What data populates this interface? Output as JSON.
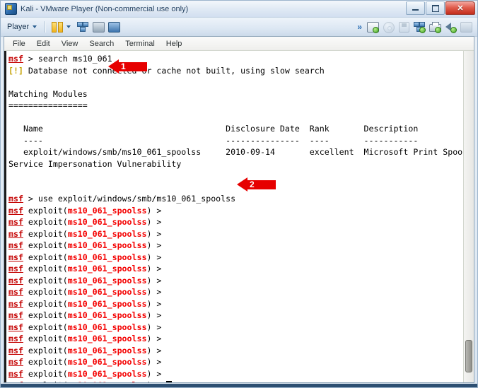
{
  "window": {
    "title": "Kali - VMware Player (Non-commercial use only)",
    "icon": "vmware-kali-icon",
    "controls": {
      "minimize": "minimize-button",
      "maximize": "maximize-button",
      "close_label": "✕"
    }
  },
  "vm_toolbar": {
    "player_label": "Player",
    "player_caret": "chevron-down-icon",
    "left_icons": [
      {
        "name": "pause-vm-icon",
        "label": "Pause"
      },
      {
        "name": "pause-dropdown-caret-icon",
        "label": "Pause options"
      },
      {
        "name": "send-ctrl-alt-del-icon",
        "label": "Send Ctrl+Alt+Del"
      },
      {
        "name": "enter-fullscreen-icon",
        "label": "Enter full screen"
      },
      {
        "name": "unity-mode-icon",
        "label": "Unity"
      }
    ],
    "right_icons": [
      {
        "name": "expand-status-chevron-icon",
        "label": "»"
      },
      {
        "name": "hard-disk-status-icon",
        "label": "Hard Disk"
      },
      {
        "name": "cd-dvd-status-icon",
        "label": "CD/DVD"
      },
      {
        "name": "floppy-status-icon",
        "label": "Floppy"
      },
      {
        "name": "network-adapter-status-icon",
        "label": "Network Adapter"
      },
      {
        "name": "printer-status-icon",
        "label": "Printer"
      },
      {
        "name": "sound-card-status-icon",
        "label": "Sound Card"
      },
      {
        "name": "usb-status-icon",
        "label": "USB"
      }
    ]
  },
  "terminal": {
    "menu": [
      "File",
      "Edit",
      "View",
      "Search",
      "Terminal",
      "Help"
    ],
    "prompt_user": "msf",
    "prompt_arrow": ">",
    "module_short_name": "ms10_061_spoolss",
    "exploit_word": "exploit",
    "lines": [
      {
        "type": "cmd",
        "prompt": "msf",
        "text": " > search ms10_061"
      },
      {
        "type": "warn",
        "tag": "[!]",
        "text": " Database not connected or cache not built, using slow search"
      },
      {
        "type": "blank",
        "text": ""
      },
      {
        "type": "plain",
        "text": "Matching Modules"
      },
      {
        "type": "plain",
        "text": "================"
      },
      {
        "type": "blank",
        "text": ""
      },
      {
        "type": "plain",
        "text": "   Name                                     Disclosure Date  Rank       Description"
      },
      {
        "type": "plain",
        "text": "   ----                                     ---------------  ----       -----------"
      },
      {
        "type": "plain",
        "text": "   exploit/windows/smb/ms10_061_spoolss     2010-09-14       excellent  Microsoft Print Spooler"
      },
      {
        "type": "plain",
        "text": "Service Impersonation Vulnerability"
      },
      {
        "type": "blank",
        "text": ""
      },
      {
        "type": "blank",
        "text": ""
      },
      {
        "type": "cmd",
        "prompt": "msf",
        "text": " > use exploit/windows/smb/ms10_061_spoolss"
      }
    ],
    "module_table": {
      "headers": [
        "Name",
        "Disclosure Date",
        "Rank",
        "Description"
      ],
      "rows": [
        {
          "name": "exploit/windows/smb/ms10_061_spoolss",
          "disclosure_date": "2010-09-14",
          "rank": "excellent",
          "description": "Microsoft Print Spooler Service Impersonation Vulnerability"
        }
      ]
    },
    "repeat_prompt_count": 16,
    "cursor": "block-cursor",
    "scrollbar": "terminal-scrollbar"
  },
  "callouts": [
    {
      "number": "1",
      "name": "callout-arrow-1",
      "target": "search ms10_061 command"
    },
    {
      "number": "2",
      "name": "callout-arrow-2",
      "target": "use exploit/windows/smb/ms10_061_spoolss command"
    }
  ],
  "colors": {
    "prompt_red": "#c40000",
    "module_red": "#f40000",
    "warn_yellow": "#c4a000",
    "callout_red": "#e60000",
    "terminal_bg": "#ffffff"
  }
}
